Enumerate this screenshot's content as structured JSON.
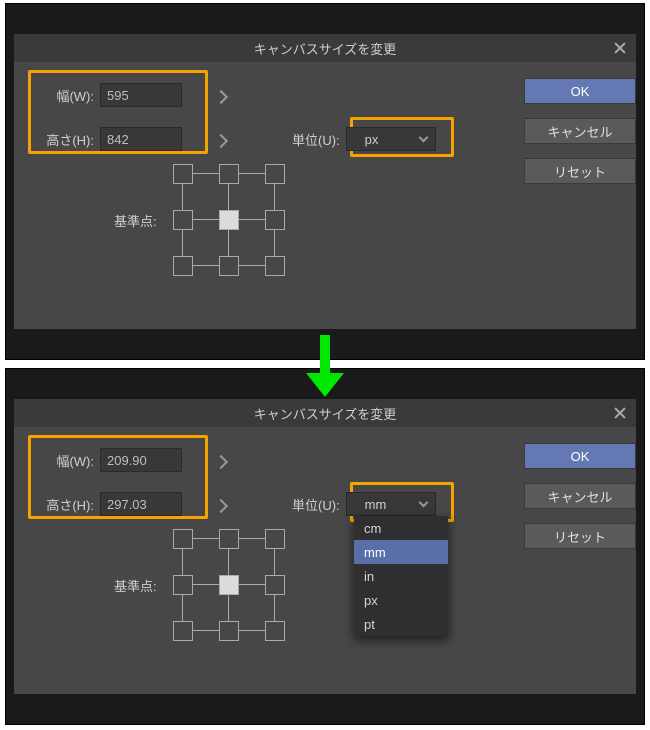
{
  "dialog": {
    "title": "キャンバスサイズを変更",
    "width_label": "幅(W):",
    "height_label": "高さ(H):",
    "unit_label": "単位(U):",
    "anchor_label": "基準点:",
    "ok_label": "OK",
    "cancel_label": "キャンセル",
    "reset_label": "リセット"
  },
  "top": {
    "width_value": "595",
    "height_value": "842",
    "unit_value": "px"
  },
  "bottom": {
    "width_value": "209.90",
    "height_value": "297.03",
    "unit_value": "mm",
    "options": {
      "0": "cm",
      "1": "mm",
      "2": "in",
      "3": "px",
      "4": "pt"
    }
  },
  "colors": {
    "highlight": "#f5a300",
    "primary": "#6478b4",
    "arrow": "#00e800"
  }
}
